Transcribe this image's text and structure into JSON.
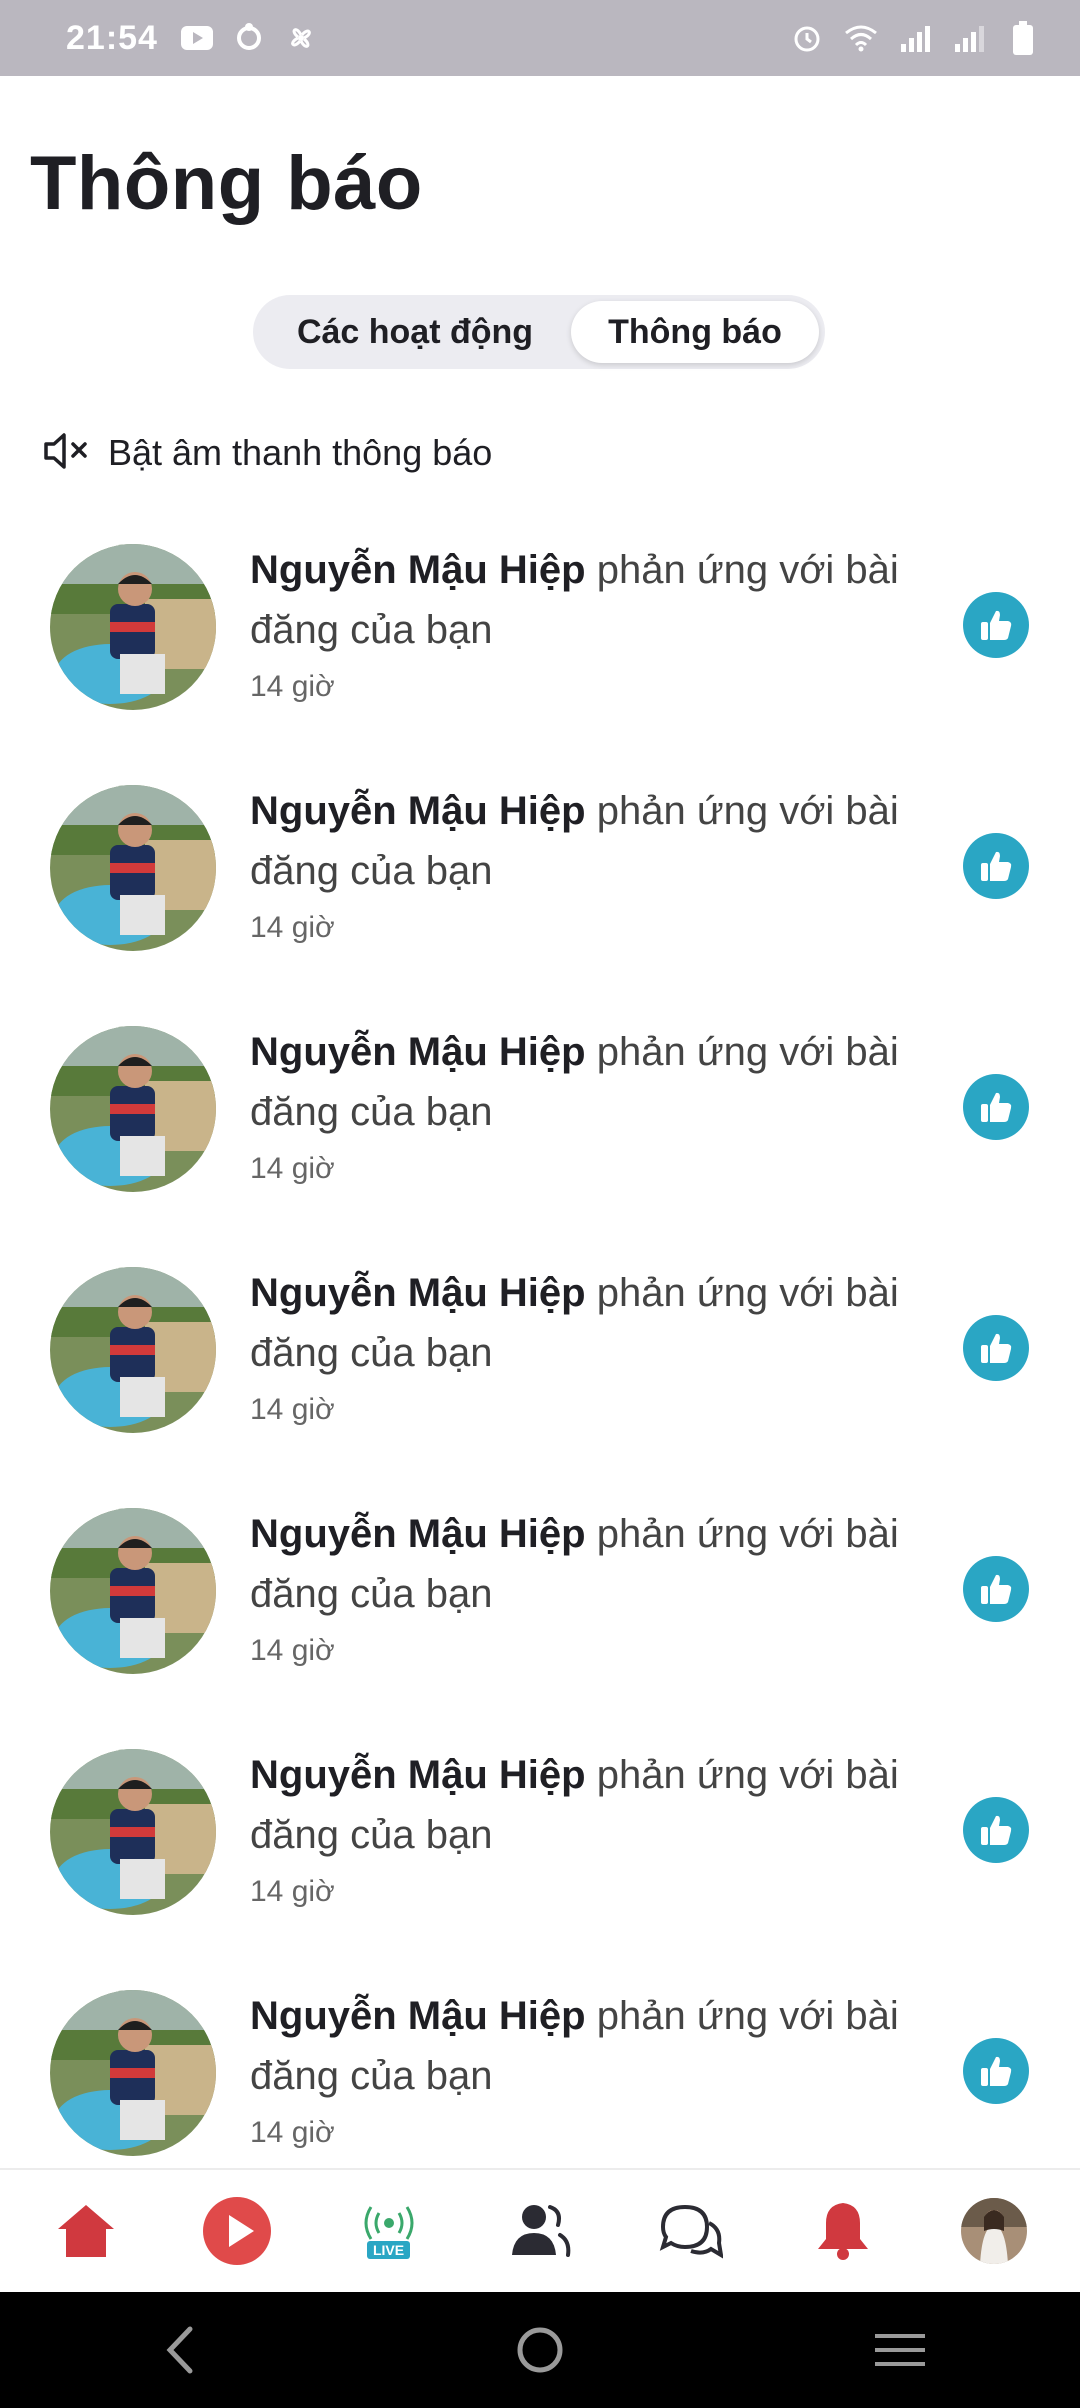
{
  "status_bar": {
    "time": "21:54",
    "left_icons": [
      "youtube-icon",
      "sync-icon",
      "fan-icon"
    ],
    "right_icons": [
      "alarm-icon",
      "wifi-icon",
      "signal-icon",
      "signal-2-icon",
      "battery-icon"
    ]
  },
  "header": {
    "title": "Thông báo"
  },
  "tabs": [
    {
      "label": "Các hoạt động",
      "active": false
    },
    {
      "label": "Thông báo",
      "active": true
    }
  ],
  "sound_toggle": {
    "icon": "mute-icon",
    "label": "Bật âm thanh thông báo"
  },
  "notifications": [
    {
      "name": "Nguyễn Mậu Hiệp",
      "action": "phản ứng với bài đăng của bạn",
      "time": "14 giờ",
      "reaction": "like-icon"
    },
    {
      "name": "Nguyễn Mậu Hiệp",
      "action": "phản ứng với bài đăng của bạn",
      "time": "14 giờ",
      "reaction": "like-icon"
    },
    {
      "name": "Nguyễn Mậu Hiệp",
      "action": "phản ứng với bài đăng của bạn",
      "time": "14 giờ",
      "reaction": "like-icon"
    },
    {
      "name": "Nguyễn Mậu Hiệp",
      "action": "phản ứng với bài đăng của bạn",
      "time": "14 giờ",
      "reaction": "like-icon"
    },
    {
      "name": "Nguyễn Mậu Hiệp",
      "action": "phản ứng với bài đăng của bạn",
      "time": "14 giờ",
      "reaction": "like-icon"
    },
    {
      "name": "Nguyễn Mậu Hiệp",
      "action": "phản ứng với bài đăng của bạn",
      "time": "14 giờ",
      "reaction": "like-icon"
    },
    {
      "name": "Nguyễn Mậu Hiệp",
      "action": "phản ứng với bài đăng của bạn",
      "time": "14 giờ",
      "reaction": "like-icon"
    }
  ],
  "bottom_nav": {
    "items": [
      {
        "icon": "home-icon"
      },
      {
        "icon": "video-play-icon"
      },
      {
        "icon": "live-icon",
        "tag": "LIVE"
      },
      {
        "icon": "friends-icon"
      },
      {
        "icon": "chat-icon"
      },
      {
        "icon": "bell-icon"
      },
      {
        "icon": "profile-avatar"
      }
    ]
  },
  "colors": {
    "accent": "#2aa6c4",
    "brand_red": "#d0393f"
  }
}
